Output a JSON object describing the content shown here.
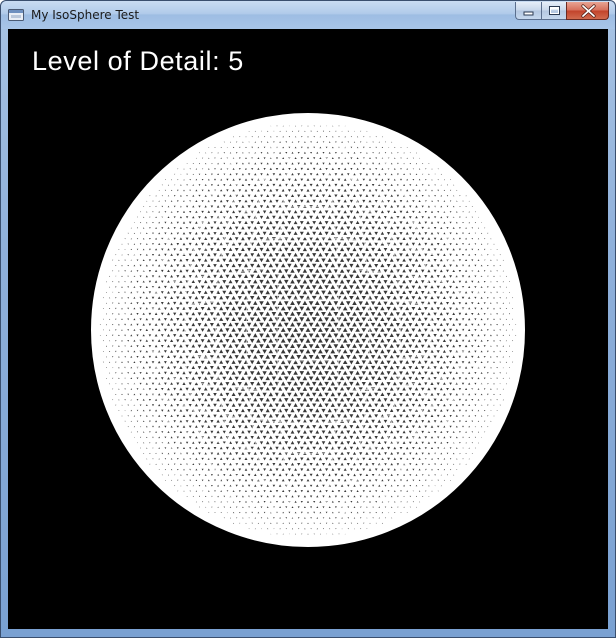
{
  "window": {
    "title": "My IsoSphere Test"
  },
  "titlebar": {
    "icon": "app-window-icon",
    "controls": [
      "minimize-icon",
      "maximize-icon",
      "close-icon"
    ]
  },
  "viewport": {
    "lod_label": "Level of Detail: 5",
    "background_color": "#000000",
    "mesh_color": "#ffffff",
    "mesh": "icosphere wireframe"
  },
  "colors": {
    "title_bar": "#b1cbea",
    "close_button": "#c2432b"
  }
}
